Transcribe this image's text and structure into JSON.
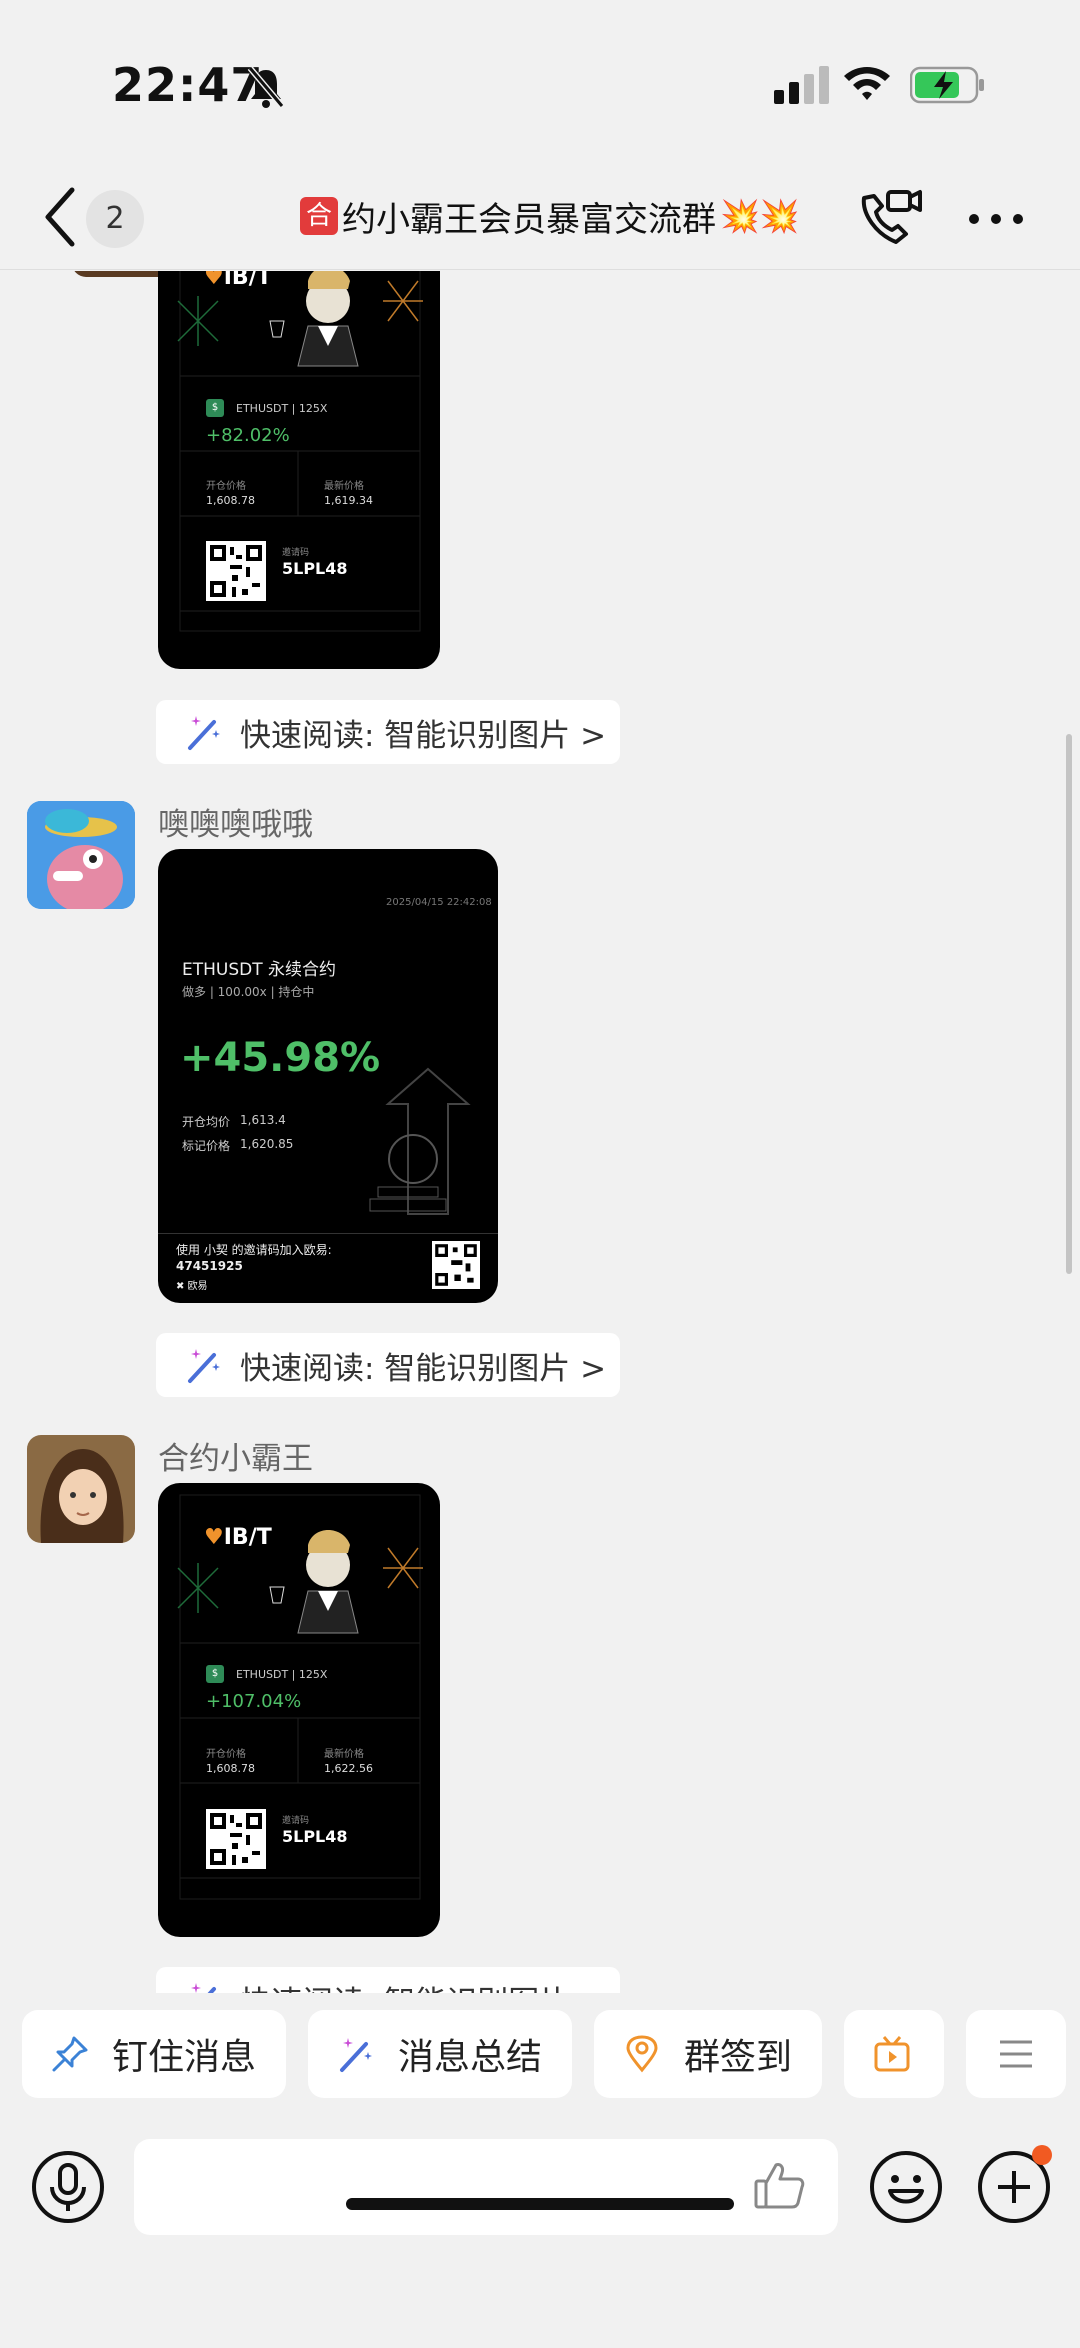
{
  "status": {
    "time": "22:47"
  },
  "header": {
    "unread": "2",
    "title_badge": "合",
    "title": "约小霸王会员暴富交流群",
    "spark": "💥💥"
  },
  "messages": [
    {
      "sender": "",
      "card": {
        "logo": "IB/T",
        "pair": "ETHUSDT | 125X",
        "pnl": "+82.02%",
        "open_label": "开仓价格",
        "open_value": "1,608.78",
        "last_label": "最新价格",
        "last_value": "1,619.34",
        "code_label": "邀请码",
        "code": "5LPL48"
      },
      "quick_read": "快速阅读: 智能识别图片 >"
    },
    {
      "sender": "噢噢噢哦哦",
      "card": {
        "date": "2025/04/15 22:42:08",
        "title": "ETHUSDT 永续合约",
        "sub": "做多 | 100.00x | 持仓中",
        "pnl": "+45.98%",
        "open_label": "开仓均价",
        "open_value": "1,613.4",
        "mark_label": "标记价格",
        "mark_value": "1,620.85",
        "footer": "使用 小契 的邀请码加入欧易:",
        "code": "47451925",
        "brand": "欧易"
      },
      "quick_read": "快速阅读: 智能识别图片 >"
    },
    {
      "sender": "合约小霸王",
      "card": {
        "logo": "IB/T",
        "pair": "ETHUSDT | 125X",
        "pnl": "+107.04%",
        "open_label": "开仓价格",
        "open_value": "1,608.78",
        "last_label": "最新价格",
        "last_value": "1,622.56",
        "code_label": "邀请码",
        "code": "5LPL48"
      },
      "quick_read": "快速阅读: 智能识别图片 >"
    }
  ],
  "shortcuts": [
    "钉住消息",
    "消息总结",
    "群签到"
  ],
  "input": {
    "placeholder": ""
  },
  "colors": {
    "accent_green": "#4fbf68",
    "badge_red": "#e23b3b",
    "orange": "#f0932c"
  }
}
